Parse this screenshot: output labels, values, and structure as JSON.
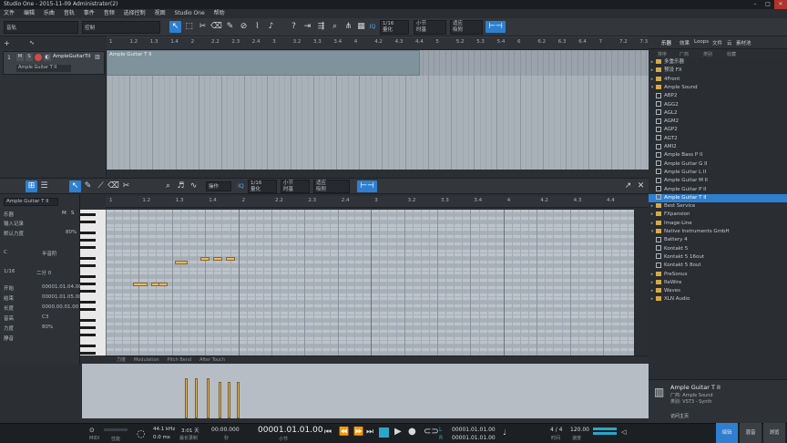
{
  "titlebar": {
    "title": "Studio One - 2015-11-09 Administrator(2)",
    "min": "–",
    "max": "□",
    "close": "✕"
  },
  "menu": [
    "文件",
    "编辑",
    "乐曲",
    "音轨",
    "事件",
    "音频",
    "选择控制",
    "视图",
    "Studio One",
    "帮助"
  ],
  "toolbar": {
    "preset_label": "音轨",
    "action_label": "控制",
    "quantize_value": "1/16",
    "quantize_sub": "量化",
    "timebase": "小节",
    "timebase_sub": "时基",
    "snap": "适应",
    "snap_sub": "吸附",
    "iq": "IQ",
    "start": "开始",
    "song": "乐曲",
    "project": "项目"
  },
  "track": {
    "m": "M",
    "s": "S",
    "name": "AmpleGuitarTII",
    "instrument": "Ample Guitar T II"
  },
  "ruler_top": [
    "1",
    "1.2",
    "1.3",
    "1.4",
    "2",
    "2.2",
    "2.3",
    "2.4",
    "3",
    "3.2",
    "3.3",
    "3.4",
    "4",
    "4.2",
    "4.3",
    "4.4",
    "5",
    "5.2",
    "5.3",
    "5.4",
    "6",
    "6.2",
    "6.3",
    "6.4",
    "7",
    "7.2",
    "7.3"
  ],
  "event": {
    "title": "Ample Guitar T II"
  },
  "editor": {
    "quantize": "1/16",
    "quantize_sub": "量化",
    "timebase": "小节",
    "timebase_sub": "时基",
    "snap": "适应",
    "snap_sub": "吸附",
    "iq": "IQ",
    "action": "操作",
    "instrument": "Ample Guitar T II",
    "ruler": [
      "1",
      "1.2",
      "1.3",
      "1.4",
      "2",
      "2.2",
      "2.3",
      "2.4",
      "3",
      "3.2",
      "3.3",
      "3.4",
      "4",
      "4.2",
      "4.3",
      "4.4"
    ]
  },
  "inspector": {
    "rows": [
      {
        "label": "乐器",
        "value": ""
      },
      {
        "label": "输入记录",
        "value": ""
      },
      {
        "label": "默认力度",
        "value": "80%"
      },
      {
        "label": "C",
        "value": "半音阶"
      },
      {
        "label": "1/16",
        "value": "二分 0"
      },
      {
        "label": "开始",
        "value": "00001.01.04.00"
      },
      {
        "label": "结束",
        "value": "00001.01.05.00"
      },
      {
        "label": "长度",
        "value": "0000.00.01.00"
      },
      {
        "label": "音高",
        "value": "C3"
      },
      {
        "label": "力度",
        "value": "80%"
      },
      {
        "label": "静音",
        "value": ""
      }
    ],
    "ms": "M",
    "ss": "S"
  },
  "controller_tabs": [
    "力度",
    "Modulation",
    "Pitch Bend",
    "After Touch"
  ],
  "right_tabs": [
    "乐器",
    "效果",
    "Loops",
    "文件",
    "云",
    "素材池"
  ],
  "right_sub": [
    "排序",
    "厂商",
    "类别",
    "收藏"
  ],
  "browser": [
    {
      "type": "folder",
      "open": false,
      "label": "多重乐器"
    },
    {
      "type": "folder",
      "open": false,
      "label": "预设 FX"
    },
    {
      "type": "folder",
      "open": false,
      "label": "4Front"
    },
    {
      "type": "folder",
      "open": true,
      "label": "Ample Sound"
    },
    {
      "type": "item",
      "label": "ABP2"
    },
    {
      "type": "item",
      "label": "AGG2"
    },
    {
      "type": "item",
      "label": "AGL2"
    },
    {
      "type": "item",
      "label": "AGM2"
    },
    {
      "type": "item",
      "label": "AGP2"
    },
    {
      "type": "item",
      "label": "AGT2"
    },
    {
      "type": "item",
      "label": "AMI2"
    },
    {
      "type": "item",
      "label": "Ample Bass P II"
    },
    {
      "type": "item",
      "label": "Ample Guitar G II"
    },
    {
      "type": "item",
      "label": "Ample Guitar L II"
    },
    {
      "type": "item",
      "label": "Ample Guitar M II"
    },
    {
      "type": "item",
      "label": "Ample Guitar P II"
    },
    {
      "type": "item",
      "label": "Ample Guitar T II",
      "selected": true
    },
    {
      "type": "folder",
      "open": false,
      "label": "Best Service"
    },
    {
      "type": "folder",
      "open": false,
      "label": "FXpansion"
    },
    {
      "type": "folder",
      "open": false,
      "label": "Image-Line"
    },
    {
      "type": "folder",
      "open": true,
      "label": "Native Instruments GmbH"
    },
    {
      "type": "item",
      "label": "Battery 4"
    },
    {
      "type": "item",
      "label": "Kontakt 5"
    },
    {
      "type": "item",
      "label": "Kontakt 5 16out"
    },
    {
      "type": "item",
      "label": "Kontakt 5 8out"
    },
    {
      "type": "folder",
      "open": false,
      "label": "PreSonus"
    },
    {
      "type": "folder",
      "open": false,
      "label": "ReWire"
    },
    {
      "type": "folder",
      "open": false,
      "label": "Waves"
    },
    {
      "type": "folder",
      "open": false,
      "label": "XLN Audio"
    }
  ],
  "plugin": {
    "name": "Ample Guitar T II",
    "vendor": "厂商: Ample Sound",
    "category": "类别: VST3 - Synth",
    "link": "访问主页"
  },
  "transport": {
    "midi": "MIDI",
    "perf": "性能",
    "samplerate": "44.1 kHz",
    "latency": "0.0 ms",
    "days": "3:01 天",
    "maxrec": "最长录制",
    "second": "00:00.000",
    "second_sub": "秒",
    "position": "00001.01.01.00",
    "position_sub": "小节",
    "l": "00001.01.01.00",
    "r": "00001.01.01.00",
    "sig": "4 / 4",
    "sig_sub": "时间",
    "tempo": "120.00",
    "tempo_sub": "速度",
    "edit": "编辑",
    "mix": "混音",
    "browse": "浏览"
  },
  "colors": {
    "accent": "#2f7fd0",
    "note": "#e5b86a",
    "event": "#7f939c"
  }
}
